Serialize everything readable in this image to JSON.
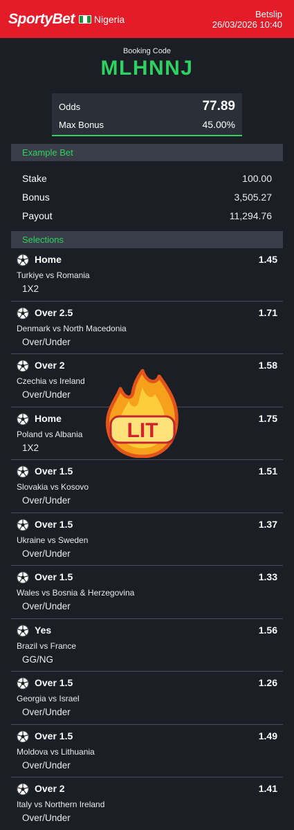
{
  "header": {
    "brand": "SportyBet",
    "country": "Nigeria",
    "page_title": "Betslip",
    "datetime": "26/03/2026 10:40",
    "bg_color": "#e41c2a"
  },
  "booking": {
    "label": "Booking Code",
    "code": "MLHNNJ",
    "code_color": "#2fd160"
  },
  "summary": {
    "odds_label": "Odds",
    "odds_value": "77.89",
    "max_bonus_label": "Max Bonus",
    "max_bonus_value": "45.00%"
  },
  "example_bet": {
    "title": "Example Bet",
    "rows": [
      {
        "label": "Stake",
        "value": "100.00"
      },
      {
        "label": "Bonus",
        "value": "3,505.27"
      },
      {
        "label": "Payout",
        "value": "11,294.76"
      }
    ]
  },
  "selections": {
    "title": "Selections",
    "items": [
      {
        "pick": "Home",
        "odd": "1.45",
        "match": "Turkiye vs Romania",
        "market": "1X2"
      },
      {
        "pick": "Over 2.5",
        "odd": "1.71",
        "match": "Denmark vs North Macedonia",
        "market": "Over/Under"
      },
      {
        "pick": "Over 2",
        "odd": "1.58",
        "match": "Czechia vs Ireland",
        "market": "Over/Under"
      },
      {
        "pick": "Home",
        "odd": "1.75",
        "match": "Poland vs Albania",
        "market": "1X2"
      },
      {
        "pick": "Over 1.5",
        "odd": "1.51",
        "match": "Slovakia vs Kosovo",
        "market": "Over/Under"
      },
      {
        "pick": "Over 1.5",
        "odd": "1.37",
        "match": "Ukraine vs Sweden",
        "market": "Over/Under"
      },
      {
        "pick": "Over 1.5",
        "odd": "1.33",
        "match": "Wales vs Bosnia & Herzegovina",
        "market": "Over/Under"
      },
      {
        "pick": "Yes",
        "odd": "1.56",
        "match": "Brazil vs France",
        "market": "GG/NG"
      },
      {
        "pick": "Over 1.5",
        "odd": "1.26",
        "match": "Georgia vs Israel",
        "market": "Over/Under"
      },
      {
        "pick": "Over 1.5",
        "odd": "1.49",
        "match": "Moldova vs Lithuania",
        "market": "Over/Under"
      },
      {
        "pick": "Over 2",
        "odd": "1.41",
        "match": "Italy vs Northern Ireland",
        "market": "Over/Under"
      }
    ]
  },
  "sticker": {
    "text": "LIT",
    "icon": "fire-icon"
  }
}
